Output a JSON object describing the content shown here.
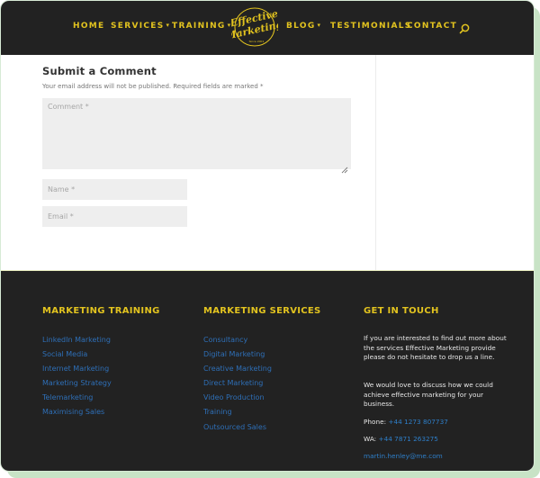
{
  "header": {
    "nav": [
      {
        "label": "HOME",
        "has_dropdown": false
      },
      {
        "label": "SERVICES",
        "has_dropdown": true
      },
      {
        "label": "TRAINING",
        "has_dropdown": true
      },
      {
        "label": "BLOG",
        "has_dropdown": true
      },
      {
        "label": "TESTIMONIALS",
        "has_dropdown": false
      },
      {
        "label": "CONTACT",
        "has_dropdown": false
      }
    ],
    "dropdown_caret": "▾",
    "logo": {
      "line1": "Effective",
      "line2": "Marketing",
      "tagline": "Since 2001"
    },
    "search_icon": "search-icon"
  },
  "comment_form": {
    "title": "Submit a Comment",
    "note": "Your email address will not be published. Required fields are marked *",
    "comment_placeholder": "Comment *",
    "name_placeholder": "Name *",
    "email_placeholder": "Email *"
  },
  "footer": {
    "training": {
      "title": "MARKETING TRAINING",
      "links": [
        "LinkedIn Marketing",
        "Social Media",
        "Internet Marketing",
        "Marketing Strategy",
        "Telemarketing",
        "Maximising Sales"
      ]
    },
    "services": {
      "title": "MARKETING SERVICES",
      "links": [
        "Consultancy",
        "Digital Marketing",
        "Creative Marketing",
        "Direct Marketing",
        "Video Production",
        "Training",
        "Outsourced Sales"
      ]
    },
    "touch": {
      "title": "GET IN TOUCH",
      "paragraph1": "If you are interested to find out more about the services Effective Marketing provide please do not hesitate to drop us a line.",
      "paragraph2": "We would love to discuss how we could achieve effective marketing for your business.",
      "phone_label": "Phone:",
      "phone": "+44 1273 807737",
      "wa_label": "WA:",
      "wa": "+44 7871 263275",
      "email": "martin.henley@me.com"
    }
  },
  "colors": {
    "header_bg": "#222222",
    "accent_yellow": "#e2c31f",
    "link_blue": "#2e6fb7",
    "frame_shadow": "#c8e3c6"
  }
}
